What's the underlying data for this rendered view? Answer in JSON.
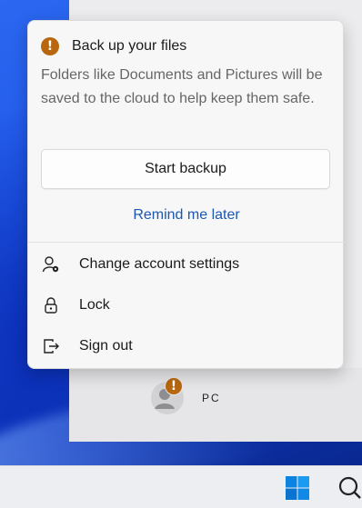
{
  "flyout": {
    "backup_title": "Back up your files",
    "backup_description": "Folders like Documents and Pictures will be saved to the cloud to help keep them safe.",
    "start_backup_label": "Start backup",
    "remind_later_label": "Remind me later",
    "menu": [
      {
        "label": "Change account settings",
        "icon": "account-settings-icon"
      },
      {
        "label": "Lock",
        "icon": "lock-icon"
      },
      {
        "label": "Sign out",
        "icon": "sign-out-icon"
      }
    ]
  },
  "account": {
    "name": "PC"
  },
  "colors": {
    "warning": "#b8670e",
    "link": "#1a57b3",
    "windows_blue": "#0078d4"
  }
}
